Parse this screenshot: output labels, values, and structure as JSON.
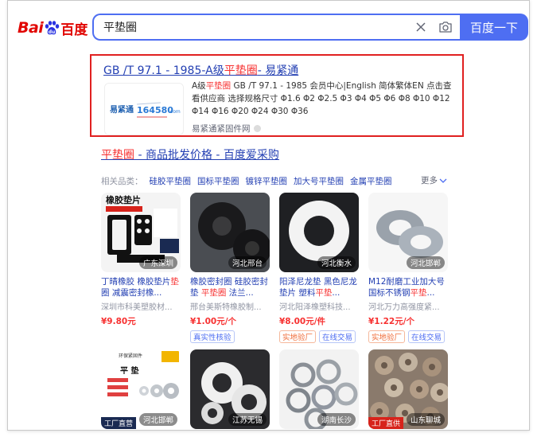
{
  "search": {
    "query": "平垫圈",
    "button_label": "百度一下"
  },
  "logo": {
    "latin": "Bai",
    "latin2": "du",
    "cn": "百度"
  },
  "result1": {
    "title_a": "GB /T 97.1 - 1985-A级",
    "title_hl": "平垫圈",
    "title_b": "- 易紧通",
    "desc_a": "A级",
    "desc_hl": "平垫圈",
    "desc_b": " GB /T 97.1 - 1985 会员中心|English 简体繁体EN 点击查看供应商 选择规格尺寸 Φ1.6 Φ2 Φ2.5 Φ3 Φ4 Φ5 Φ6 Φ8 Φ10 Φ12 Φ14 Φ16 Φ20 Φ24 Φ30 Φ36",
    "source": "易紧通紧固件网",
    "thumb_text": "易紧通",
    "thumb_num": "164580",
    "thumb_com": ".com"
  },
  "result2": {
    "title_hl": "平垫圈",
    "title_rest": " - 商品批发价格 - 百度爱采购",
    "related_label": "相关品类：",
    "related": [
      "硅胶平垫圈",
      "国标平垫圈",
      "镀锌平垫圈",
      "加大号平垫圈",
      "金属平垫圈"
    ],
    "more": "更多",
    "products": [
      {
        "img_title": "橡胶垫片",
        "location": "广东深圳",
        "title_a": "丁晴橡胶 橡胶垫片",
        "title_hl": "垫",
        "title_b": "圈 减震密封橡...",
        "shop": "深圳市科美塑胶材...",
        "price": "¥9.80元",
        "tags": []
      },
      {
        "location": "河北邢台",
        "title_a": "橡胶密封圈 硅胶密封垫 ",
        "title_hl": "平垫圈",
        "title_b": " 法兰...",
        "shop": "邢台美斯特橡胶制...",
        "price": "¥1.00元/个",
        "tags": [
          "真实性核验"
        ]
      },
      {
        "location": "河北衡水",
        "title_a": "阳泽尼龙垫 黑色尼龙垫片 塑料",
        "title_hl": "平垫",
        "title_b": "...",
        "shop": "河北阳泽橡塑科技...",
        "price": "¥8.00元/件",
        "tags": [
          "实地验厂",
          "在线交易"
        ]
      },
      {
        "location": "河北邯郸",
        "title_a": "M12耐磨工业加大号国标不锈钢",
        "title_hl": "平垫",
        "title_b": "...",
        "shop": "河北万力高强度紧...",
        "price": "¥1.22元/个",
        "tags": [
          "实地验厂",
          "在线交易"
        ]
      },
      {
        "img_title": "平 垫",
        "brand": "环保紧固件",
        "corner": "工厂直营",
        "location": "河北邯郸"
      },
      {
        "location": "江苏无锡"
      },
      {
        "location": "湖南长沙"
      },
      {
        "corner": "工厂直供",
        "location": "山东聊城"
      }
    ]
  }
}
